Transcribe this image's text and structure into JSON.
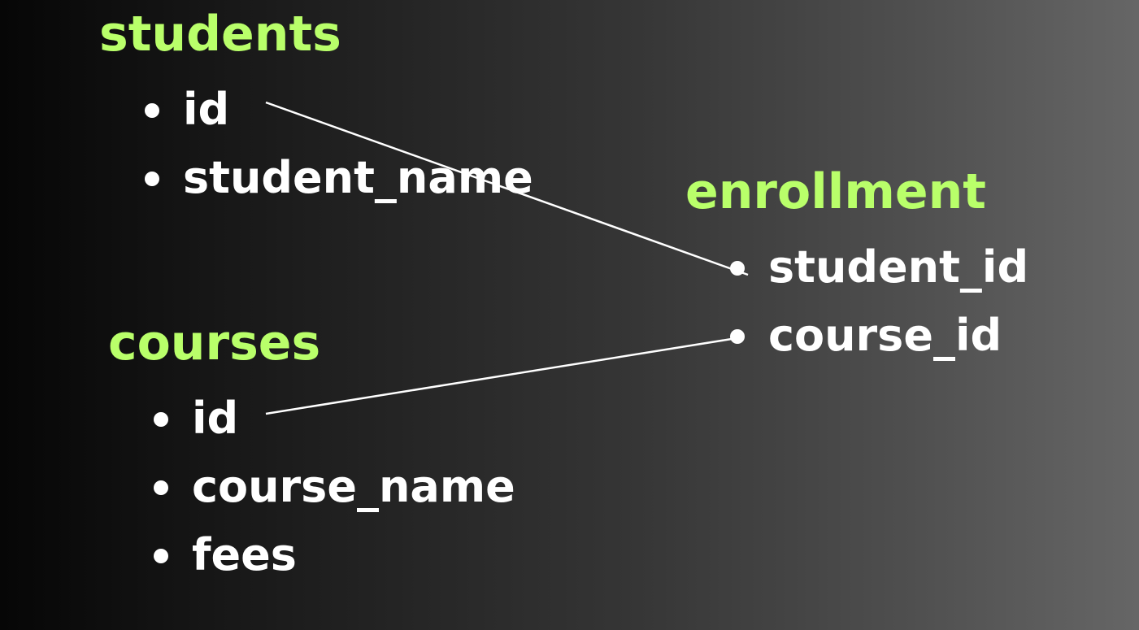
{
  "tables": {
    "students": {
      "title": "students",
      "fields": [
        "id",
        "student_name"
      ]
    },
    "courses": {
      "title": "courses",
      "fields": [
        "id",
        "course_name",
        "fees"
      ]
    },
    "enrollment": {
      "title": "enrollment",
      "fields": [
        "student_id",
        "course_id"
      ]
    }
  },
  "relations": [
    {
      "from": "students.id",
      "to": "enrollment.student_id"
    },
    {
      "from": "courses.id",
      "to": "enrollment.course_id"
    }
  ],
  "colors": {
    "title": "#b9ff6a",
    "field": "#ffffff",
    "connector": "#ffffff",
    "background_start": "#060606",
    "background_end": "#666666"
  }
}
